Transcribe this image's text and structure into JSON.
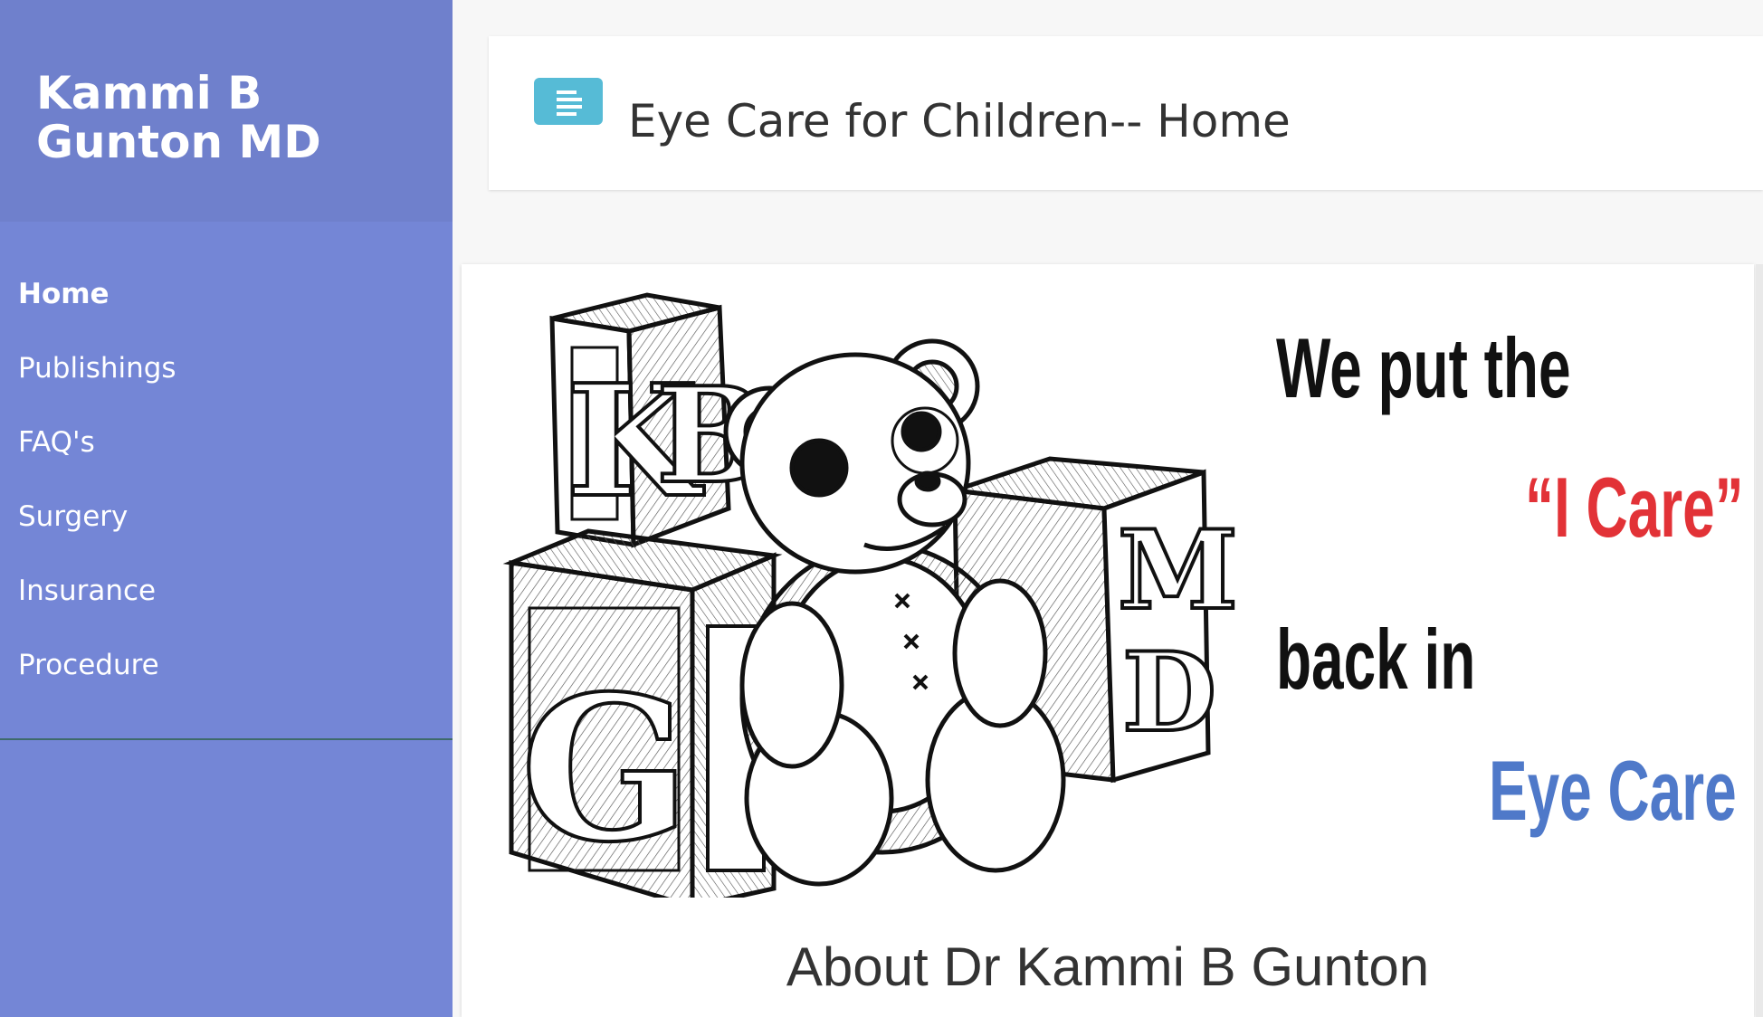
{
  "sidebar": {
    "brand": "Kammi B Gunton MD",
    "items": [
      {
        "label": "Home",
        "active": true
      },
      {
        "label": "Publishings",
        "active": false
      },
      {
        "label": "FAQ's",
        "active": false
      },
      {
        "label": "Surgery",
        "active": false
      },
      {
        "label": "Insurance",
        "active": false
      },
      {
        "label": "Procedure",
        "active": false
      }
    ]
  },
  "topbar": {
    "menu_icon": "menu-lines-icon",
    "title": "Eye Care for Children-- Home"
  },
  "banner": {
    "block_letters": [
      "K",
      "B",
      "G",
      "M",
      "D"
    ],
    "line1": "We put the",
    "line2": "“I Care”",
    "line3": "back in",
    "line4": "Eye Care",
    "colors": {
      "dark": "#111111",
      "red": "#e23237",
      "blue": "#4f79c9"
    }
  },
  "main": {
    "about_heading": "About Dr Kammi B Gunton"
  },
  "colors": {
    "sidebar": "#7486d6",
    "sidebar_header": "#6f80cc",
    "toggle": "#56bbd6",
    "background": "#f7f7f7"
  }
}
